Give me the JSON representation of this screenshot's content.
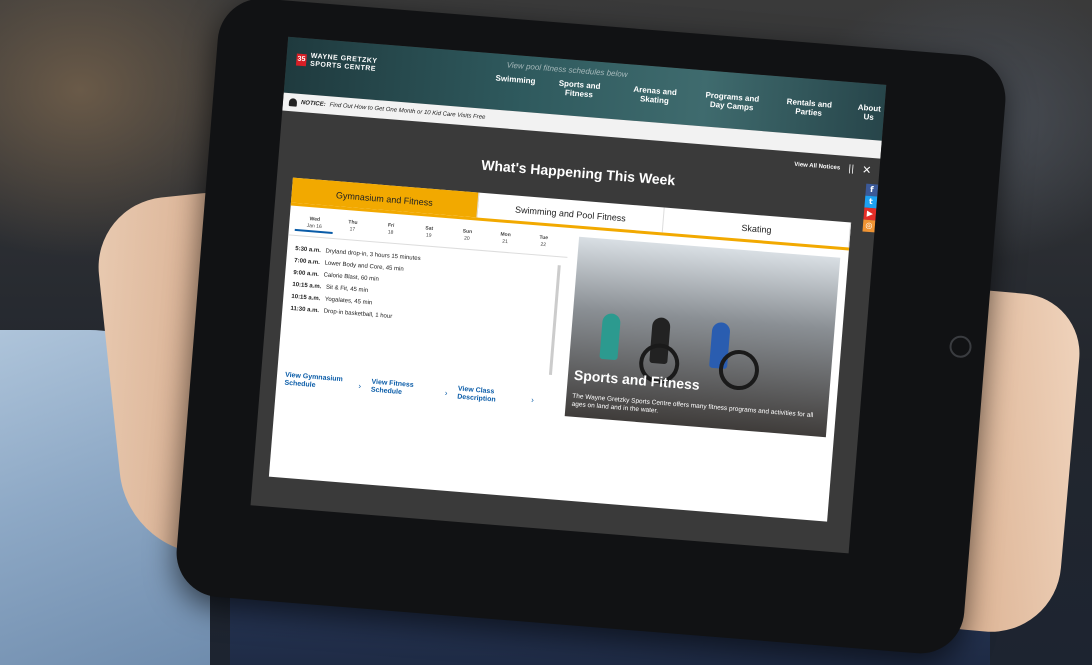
{
  "header": {
    "logo_mark": "35",
    "logo_line1": "WAYNE GRETZKY",
    "logo_line2": "SPORTS CENTRE",
    "tagline": "View pool fitness schedules below",
    "nav": [
      "Swimming",
      "Sports and Fitness",
      "Arenas and Skating",
      "Programs and Day Camps",
      "Rentals and Parties",
      "About Us"
    ]
  },
  "notice": {
    "label": "NOTICE:",
    "text": "Find Out How to Get One Month or 10 Kid Care Visits Free",
    "view_all": "View All Notices"
  },
  "section_title": "What's Happening This Week",
  "social": [
    "facebook-icon",
    "twitter-icon",
    "youtube-icon",
    "instagram-icon"
  ],
  "tabs": [
    "Gymnasium and Fitness",
    "Swimming and Pool Fitness",
    "Skating"
  ],
  "days": [
    {
      "name": "Wed",
      "date": "Jan 16"
    },
    {
      "name": "Thu",
      "date": "17"
    },
    {
      "name": "Fri",
      "date": "18"
    },
    {
      "name": "Sat",
      "date": "19"
    },
    {
      "name": "Sun",
      "date": "20"
    },
    {
      "name": "Mon",
      "date": "21"
    },
    {
      "name": "Tue",
      "date": "22"
    }
  ],
  "events": [
    {
      "time": "5:30 a.m.",
      "desc": "Dryland drop-in, 3 hours 15 minutes"
    },
    {
      "time": "7:00 a.m.",
      "desc": "Lower Body and Core, 45 min"
    },
    {
      "time": "9:00 a.m.",
      "desc": "Calorie Blast, 60 min"
    },
    {
      "time": "10:15 a.m.",
      "desc": "Sit & Fit, 45 min"
    },
    {
      "time": "10:15 a.m.",
      "desc": "Yogalates, 45 min"
    },
    {
      "time": "11:30 a.m.",
      "desc": "Drop-in basketball, 1 hour"
    }
  ],
  "links": [
    "View Gymnasium Schedule",
    "View Fitness Schedule",
    "View Class Description"
  ],
  "feature": {
    "title": "Sports and Fitness",
    "desc": "The Wayne Gretzky Sports Centre offers many fitness programs and activities for all ages on land and in the water."
  },
  "colors": {
    "accent": "#f2a900",
    "link": "#0a5ca8",
    "brand_red": "#d81f26"
  }
}
